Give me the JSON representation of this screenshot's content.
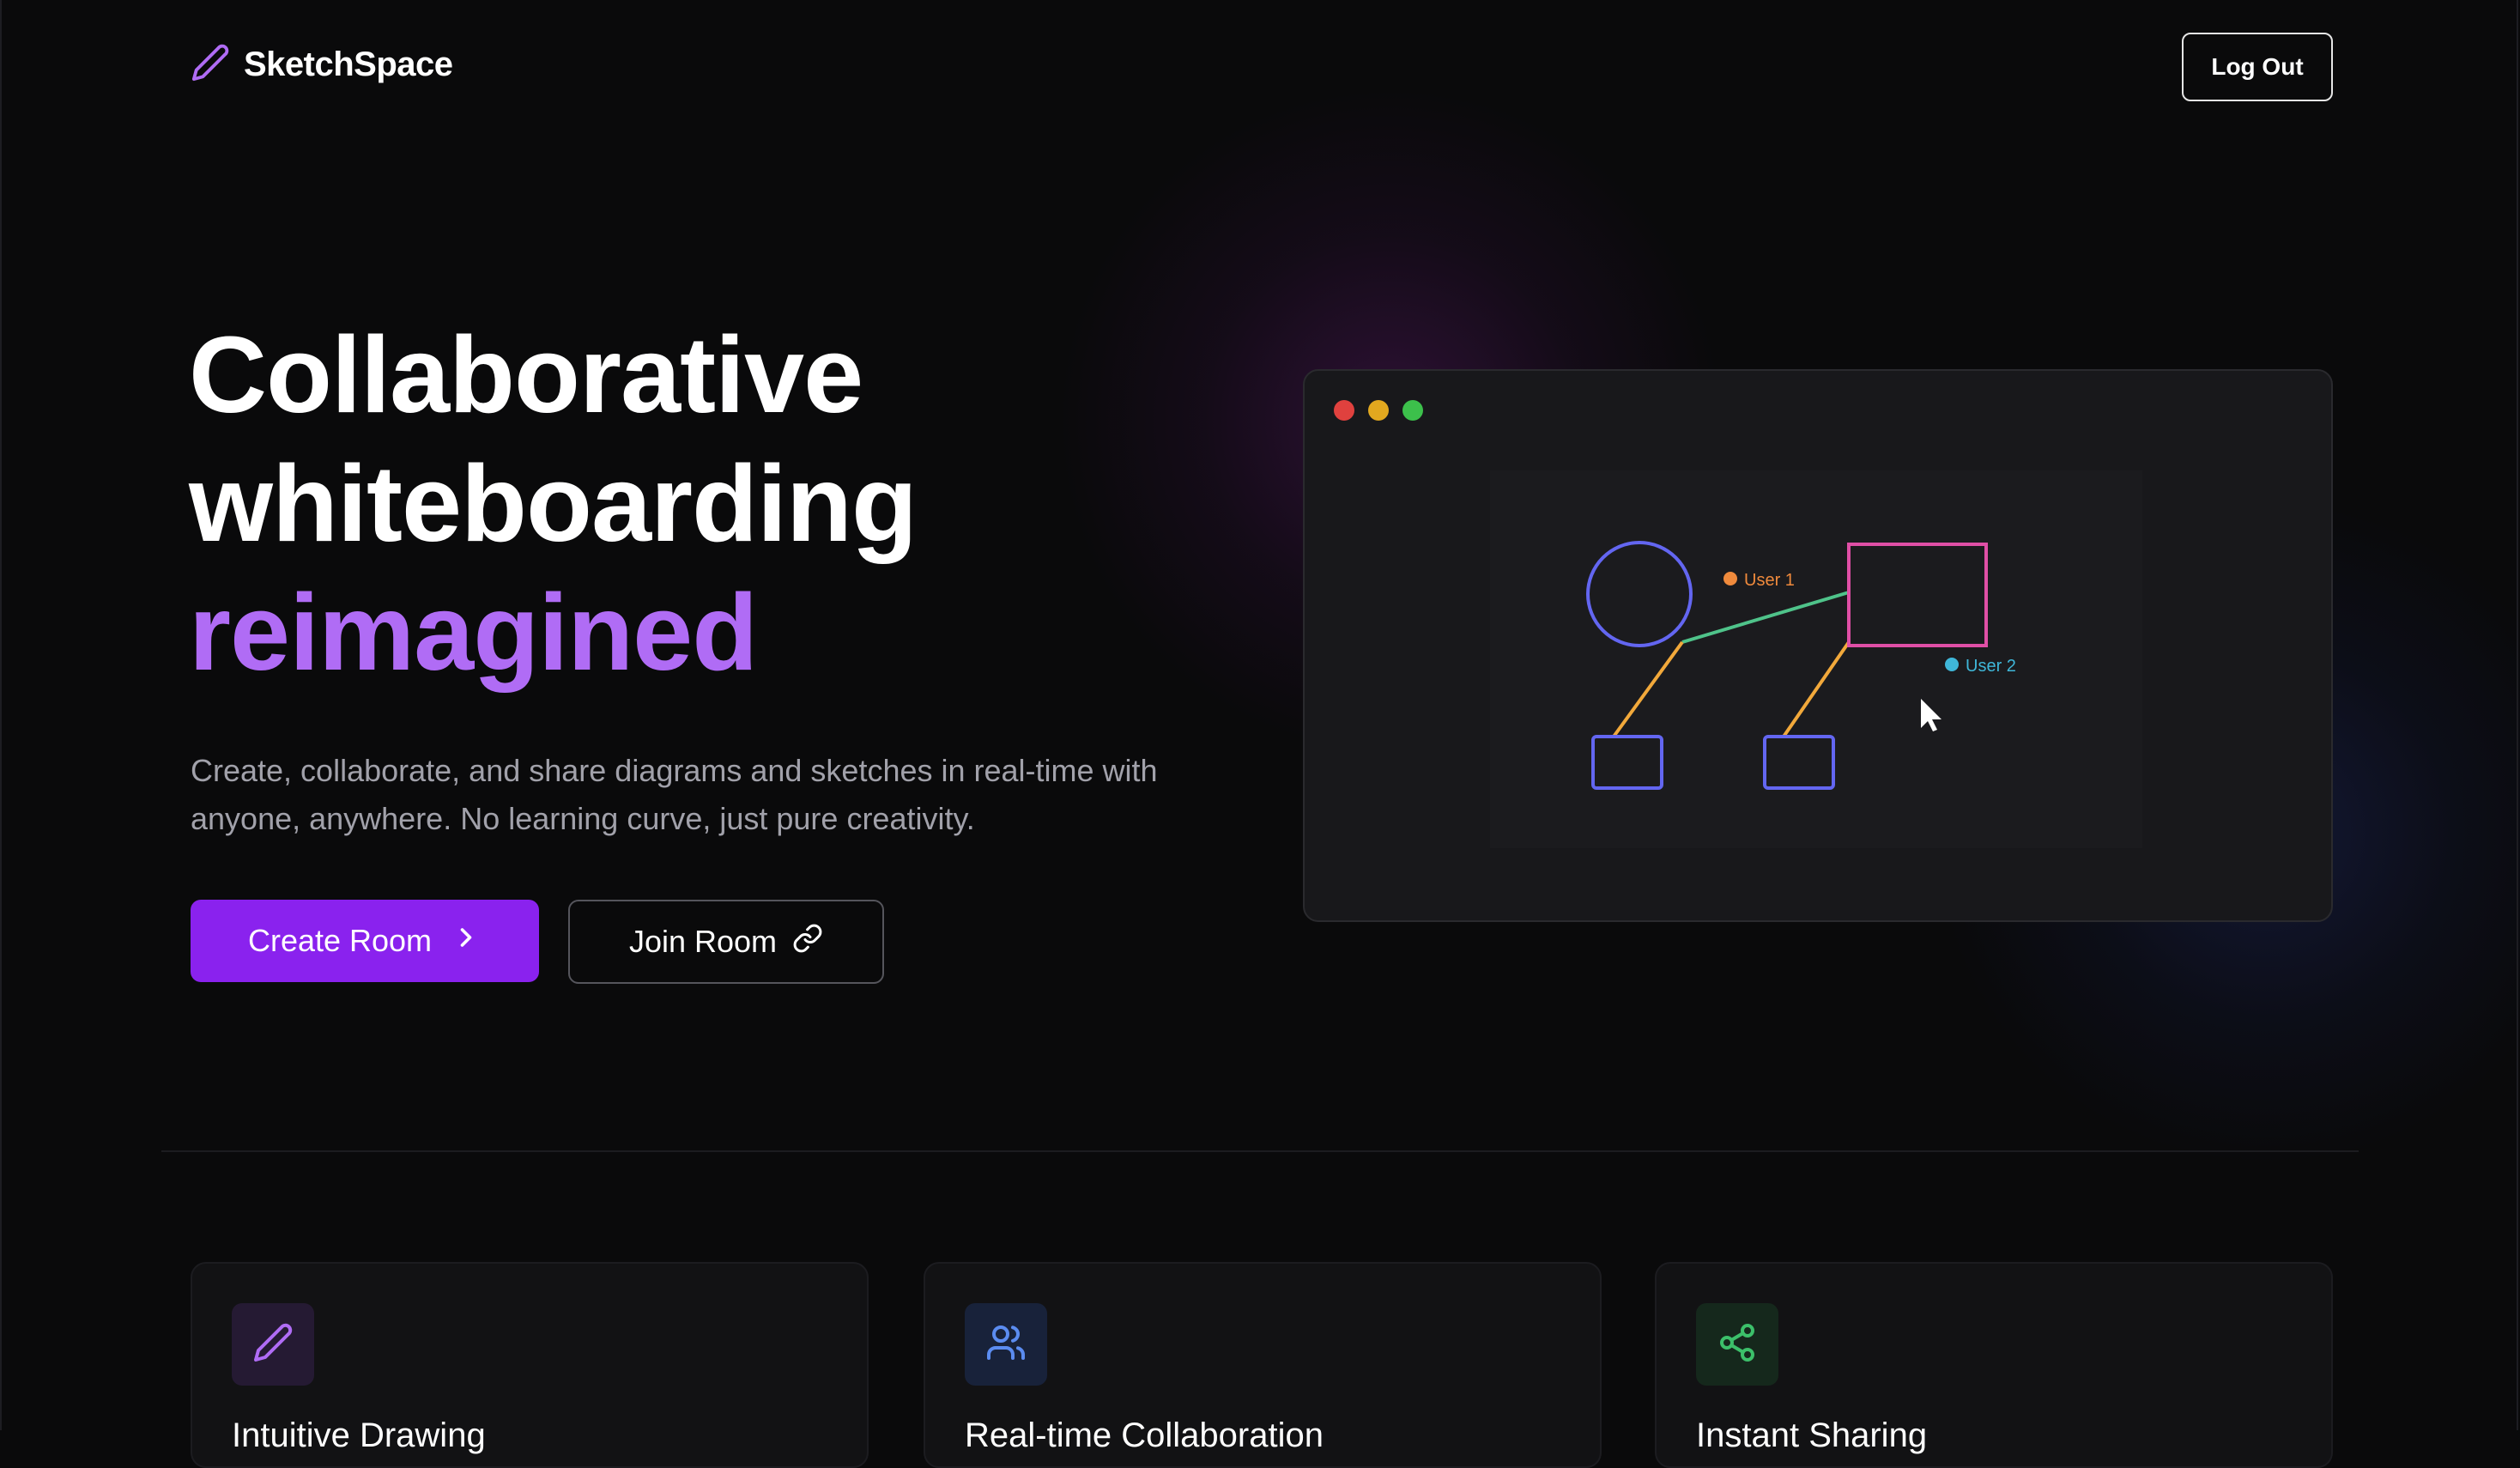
{
  "brand": {
    "name": "SketchSpace",
    "accent": "#b06cf5"
  },
  "nav": {
    "logout_label": "Log Out"
  },
  "hero": {
    "title_line1": "Collaborative",
    "title_line2": "whiteboarding",
    "title_accent": "reimagined",
    "subtitle": "Create, collaborate, and share diagrams and sketches in real-time with anyone, anywhere. No learning curve, just pure creativity.",
    "create_label": "Create Room",
    "join_label": "Join Room"
  },
  "preview": {
    "user1_label": "User 1",
    "user2_label": "User 2",
    "colors": {
      "user1": "#f08a3c",
      "user2": "#3fb7d9",
      "circle": "#6366f1",
      "rect": "#e04fa6",
      "link": "#4fc38a",
      "connector": "#f2a93b"
    }
  },
  "features": [
    {
      "title": "Intuitive Drawing",
      "icon": "pencil-icon",
      "color": "#b06cf5"
    },
    {
      "title": "Real-time Collaboration",
      "icon": "users-icon",
      "color": "#5b8cf0"
    },
    {
      "title": "Instant Sharing",
      "icon": "share-icon",
      "color": "#3cc06a"
    }
  ]
}
